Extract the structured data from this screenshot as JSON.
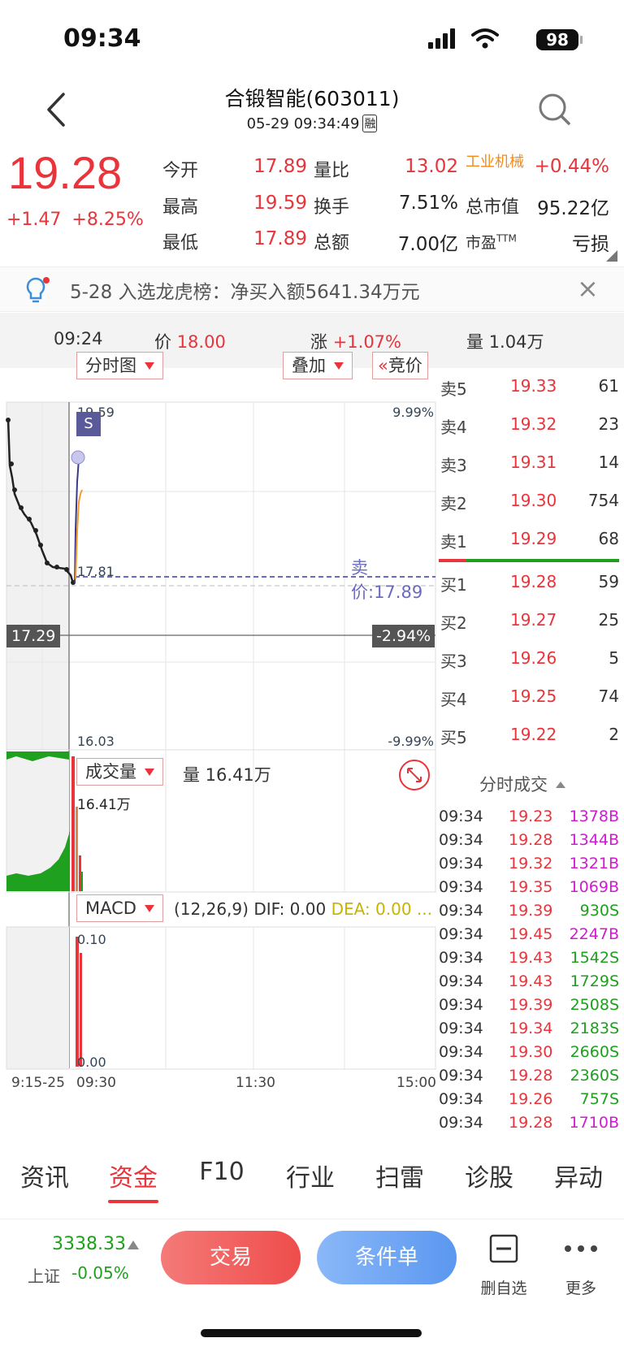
{
  "status_bar": {
    "time": "09:34",
    "battery": "98"
  },
  "header": {
    "title": "合锻智能(603011)",
    "datetime": "05-29 09:34:49",
    "margin_badge": "融"
  },
  "quote": {
    "price": "19.28",
    "change": "+1.47",
    "change_pct": "+8.25%",
    "open_label": "今开",
    "open": "17.89",
    "high_label": "最高",
    "high": "19.59",
    "low_label": "最低",
    "low": "17.89",
    "vol_ratio_label": "量比",
    "vol_ratio": "13.02",
    "turnover_label": "换手",
    "turnover": "7.51%",
    "amount_label": "总额",
    "amount": "7.00亿",
    "industry": "工业机械",
    "industry_change": "+0.44%",
    "mktcap_label": "总市值",
    "mktcap": "95.22亿",
    "pe_label": "市盈",
    "pe_sup": "TTM",
    "pe": "亏损"
  },
  "notice": {
    "text": "5-28 入选龙虎榜：净买入额5641.34万元"
  },
  "info_row": {
    "time": "09:24",
    "price_label": "价",
    "price": "18.00",
    "change_label": "涨",
    "change": "+1.07%",
    "volume_label": "量",
    "volume": "1.04万"
  },
  "chart": {
    "tabs": {
      "intraday": "分时图",
      "overlay": "叠加",
      "auction": "竞价",
      "auction_prefix": "«"
    },
    "price_top": "19.59",
    "pct_top": "9.99%",
    "price_bottom": "16.03",
    "pct_bottom": "-9.99%",
    "ask_marker_left": "17.81",
    "ask_line_label": "卖价:17.89",
    "prev_close": "17.29",
    "prev_close_pct": "-2.94%",
    "signal": "S",
    "volume_tab": "成交量",
    "volume_text": "量 16.41万",
    "volume_max": "16.41万",
    "macd_tab": "MACD",
    "macd_params": "(12,26,9)",
    "macd_dif": "DIF: 0.00",
    "macd_dea": "DEA: 0.00",
    "macd_more": "...",
    "macd_top": "0.10",
    "macd_bottom": "0.00",
    "time_labels": [
      "9:15-25",
      "09:30",
      "11:30",
      "15:00"
    ]
  },
  "order_book": {
    "asks": [
      {
        "label": "卖5",
        "price": "19.33",
        "vol": "61"
      },
      {
        "label": "卖4",
        "price": "19.32",
        "vol": "23"
      },
      {
        "label": "卖3",
        "price": "19.31",
        "vol": "14"
      },
      {
        "label": "卖2",
        "price": "19.30",
        "vol": "754"
      },
      {
        "label": "卖1",
        "price": "19.29",
        "vol": "68"
      }
    ],
    "bids": [
      {
        "label": "买1",
        "price": "19.28",
        "vol": "59"
      },
      {
        "label": "买2",
        "price": "19.27",
        "vol": "25"
      },
      {
        "label": "买3",
        "price": "19.26",
        "vol": "5"
      },
      {
        "label": "买4",
        "price": "19.25",
        "vol": "74"
      },
      {
        "label": "买5",
        "price": "19.22",
        "vol": "2"
      }
    ]
  },
  "trades": {
    "title": "分时成交",
    "rows": [
      {
        "time": "09:34",
        "price": "19.23",
        "vol": "1378",
        "side": "B"
      },
      {
        "time": "09:34",
        "price": "19.28",
        "vol": "1344",
        "side": "B"
      },
      {
        "time": "09:34",
        "price": "19.32",
        "vol": "1321",
        "side": "B"
      },
      {
        "time": "09:34",
        "price": "19.35",
        "vol": "1069",
        "side": "B"
      },
      {
        "time": "09:34",
        "price": "19.39",
        "vol": "930",
        "side": "S"
      },
      {
        "time": "09:34",
        "price": "19.45",
        "vol": "2247",
        "side": "B"
      },
      {
        "time": "09:34",
        "price": "19.43",
        "vol": "1542",
        "side": "S"
      },
      {
        "time": "09:34",
        "price": "19.43",
        "vol": "1729",
        "side": "S"
      },
      {
        "time": "09:34",
        "price": "19.39",
        "vol": "2508",
        "side": "S"
      },
      {
        "time": "09:34",
        "price": "19.34",
        "vol": "2183",
        "side": "S"
      },
      {
        "time": "09:34",
        "price": "19.30",
        "vol": "2660",
        "side": "S"
      },
      {
        "time": "09:34",
        "price": "19.28",
        "vol": "2360",
        "side": "S"
      },
      {
        "time": "09:34",
        "price": "19.26",
        "vol": "757",
        "side": "S"
      },
      {
        "time": "09:34",
        "price": "19.28",
        "vol": "1710",
        "side": "B"
      }
    ]
  },
  "tabs": [
    "资讯",
    "资金",
    "F10",
    "行业",
    "扫雷",
    "诊股",
    "异动"
  ],
  "bottom": {
    "index_value": "3338.33",
    "index_name": "上证",
    "index_change": "-0.05%",
    "trade_label": "交易",
    "cond_label": "条件单",
    "del_fav_label": "删自选",
    "more_label": "更多"
  },
  "colors": {
    "up": "#e8343a",
    "down": "#1ea01e",
    "buy_side": "#d21ad2",
    "sell_side": "#1ea01e"
  }
}
